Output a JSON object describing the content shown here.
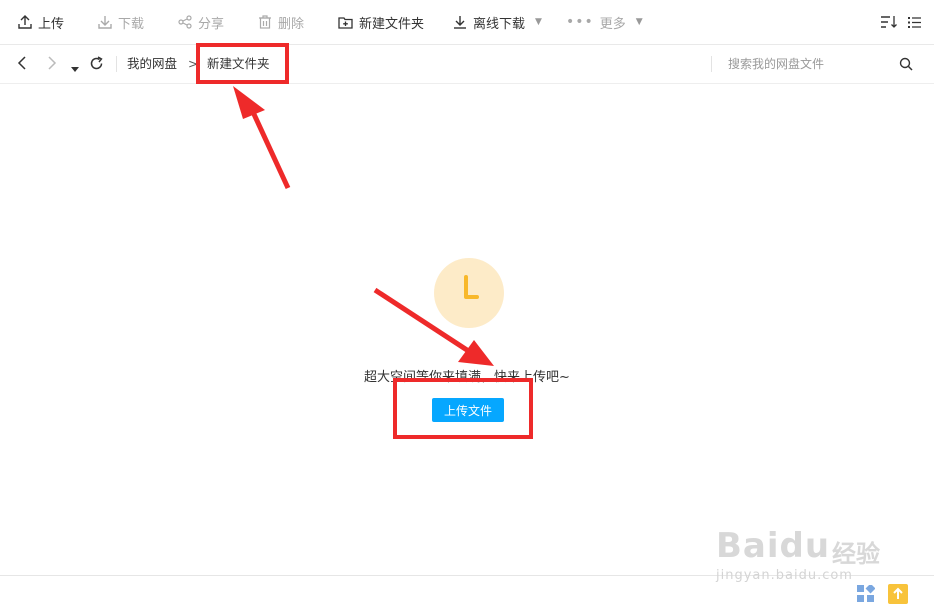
{
  "toolbar": {
    "upload": "上传",
    "download": "下载",
    "share": "分享",
    "delete": "删除",
    "new_folder": "新建文件夹",
    "offline_download": "离线下载",
    "more": "更多"
  },
  "nav": {
    "root": "我的网盘",
    "separator": ">",
    "current": "新建文件夹",
    "search_placeholder": "搜索我的网盘文件"
  },
  "empty": {
    "message": "超大空间等你来填满，快来上传吧~",
    "upload_button": "上传文件"
  },
  "watermark": {
    "brand": "Baidu",
    "product": "经验",
    "url": "jingyan.baidu.com"
  },
  "colors": {
    "accent": "#06a7ff",
    "annotation": "#ee2a2a",
    "clock_bg": "#fdebc8",
    "clock_hands": "#f8b82b"
  }
}
